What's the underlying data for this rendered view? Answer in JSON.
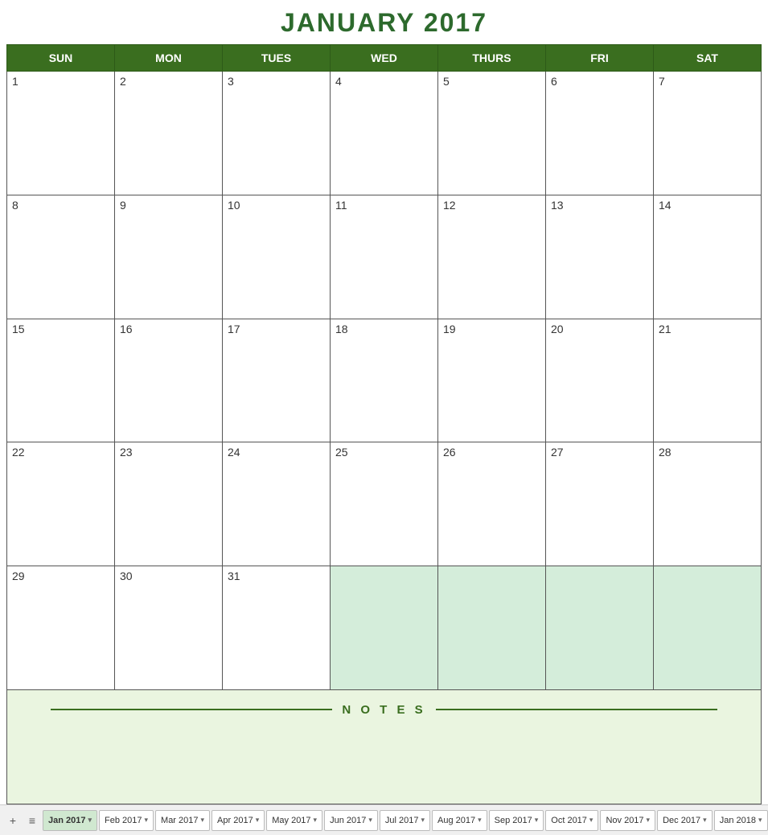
{
  "title": "JANUARY 2017",
  "header": {
    "days": [
      "SUN",
      "MON",
      "TUES",
      "WED",
      "THURS",
      "FRI",
      "SAT"
    ]
  },
  "weeks": [
    [
      {
        "day": "1",
        "nextMonth": false
      },
      {
        "day": "2",
        "nextMonth": false
      },
      {
        "day": "3",
        "nextMonth": false
      },
      {
        "day": "4",
        "nextMonth": false
      },
      {
        "day": "5",
        "nextMonth": false
      },
      {
        "day": "6",
        "nextMonth": false
      },
      {
        "day": "7",
        "nextMonth": false
      }
    ],
    [
      {
        "day": "8",
        "nextMonth": false
      },
      {
        "day": "9",
        "nextMonth": false
      },
      {
        "day": "10",
        "nextMonth": false
      },
      {
        "day": "11",
        "nextMonth": false
      },
      {
        "day": "12",
        "nextMonth": false
      },
      {
        "day": "13",
        "nextMonth": false
      },
      {
        "day": "14",
        "nextMonth": false
      }
    ],
    [
      {
        "day": "15",
        "nextMonth": false
      },
      {
        "day": "16",
        "nextMonth": false
      },
      {
        "day": "17",
        "nextMonth": false
      },
      {
        "day": "18",
        "nextMonth": false
      },
      {
        "day": "19",
        "nextMonth": false
      },
      {
        "day": "20",
        "nextMonth": false
      },
      {
        "day": "21",
        "nextMonth": false
      }
    ],
    [
      {
        "day": "22",
        "nextMonth": false
      },
      {
        "day": "23",
        "nextMonth": false
      },
      {
        "day": "24",
        "nextMonth": false
      },
      {
        "day": "25",
        "nextMonth": false
      },
      {
        "day": "26",
        "nextMonth": false
      },
      {
        "day": "27",
        "nextMonth": false
      },
      {
        "day": "28",
        "nextMonth": false
      }
    ],
    [
      {
        "day": "29",
        "nextMonth": false
      },
      {
        "day": "30",
        "nextMonth": false
      },
      {
        "day": "31",
        "nextMonth": false
      },
      {
        "day": "",
        "nextMonth": true
      },
      {
        "day": "",
        "nextMonth": true
      },
      {
        "day": "",
        "nextMonth": true
      },
      {
        "day": "",
        "nextMonth": true
      }
    ]
  ],
  "notes_label": "N O T E S",
  "tabs": [
    {
      "label": "Jan 2017",
      "active": true
    },
    {
      "label": "Feb 2017",
      "active": false
    },
    {
      "label": "Mar 2017",
      "active": false
    },
    {
      "label": "Apr 2017",
      "active": false
    },
    {
      "label": "May 2017",
      "active": false
    },
    {
      "label": "Jun 2017",
      "active": false
    },
    {
      "label": "Jul 2017",
      "active": false
    },
    {
      "label": "Aug 2017",
      "active": false
    },
    {
      "label": "Sep 2017",
      "active": false
    },
    {
      "label": "Oct 2017",
      "active": false
    },
    {
      "label": "Nov 2017",
      "active": false
    },
    {
      "label": "Dec 2017",
      "active": false
    },
    {
      "label": "Jan 2018",
      "active": false
    }
  ],
  "add_icon": "+",
  "menu_icon": "≡"
}
